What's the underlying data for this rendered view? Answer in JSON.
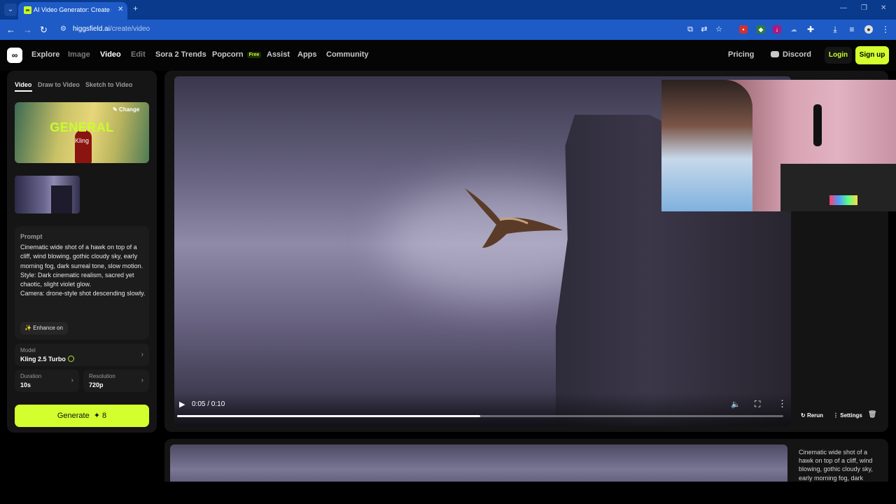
{
  "browser": {
    "tab_title": "AI Video Generator: Create stunning",
    "url_domain": "higgsfield.ai",
    "url_path": "/create/video"
  },
  "header": {
    "nav": [
      "Explore",
      "Image",
      "Video",
      "Edit",
      "Sora 2 Trends",
      "Popcorn",
      "Assist",
      "Apps",
      "Community"
    ],
    "free_badge": "Free",
    "pricing": "Pricing",
    "discord": "Discord",
    "login": "Login",
    "signup": "Sign up"
  },
  "left": {
    "tabs": [
      "Video",
      "Draw to Video",
      "Sketch to Video"
    ],
    "preset": {
      "title": "GENERAL",
      "subtitle": "Kling",
      "change": "Change"
    },
    "prompt": {
      "label": "Prompt",
      "text": "Cinematic wide shot of a hawk on top of a cliff, wind blowing, gothic cloudy sky, early morning fog, dark surreal tone, slow motion.\nStyle: Dark cinematic realism, sacred yet chaotic, slight violet glow.\nCamera: drone-style shot descending slowly.",
      "enhance": "Enhance on"
    },
    "model": {
      "label": "Model",
      "value": "Kling 2.5 Turbo"
    },
    "duration": {
      "label": "Duration",
      "value": "10s"
    },
    "resolution": {
      "label": "Resolution",
      "value": "720p"
    },
    "generate": {
      "label": "Generate",
      "cost": "8"
    }
  },
  "player": {
    "time": "0:05 / 0:10",
    "progress": 0.5,
    "actions": {
      "rerun": "Rerun",
      "settings": "Settings"
    }
  },
  "second": {
    "prompt_preview": "Cinematic wide shot of a hawk on top of a cliff, wind blowing, gothic cloudy sky, early morning fog, dark"
  },
  "colors": {
    "accent": "#d4ff2e",
    "browser_blue": "#1e5bc6",
    "panel": "#151515"
  }
}
